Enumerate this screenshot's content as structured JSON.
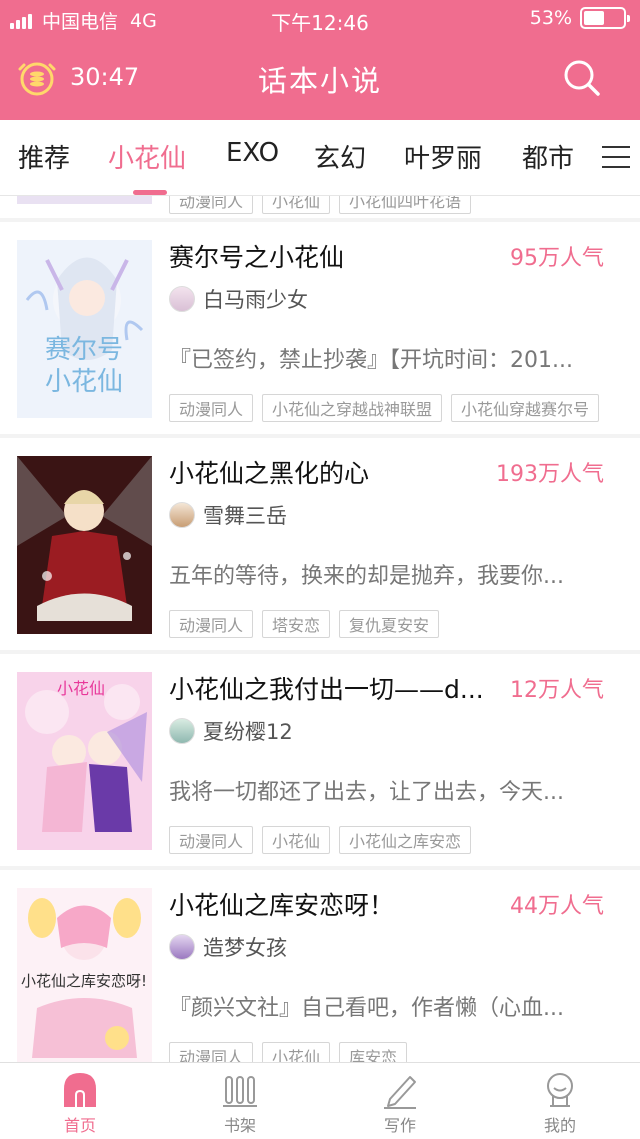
{
  "status_bar": {
    "carrier": "中国电信",
    "network": "4G",
    "time": "下午12:46",
    "battery_percent": "53%",
    "battery_level": 0.53
  },
  "title_bar": {
    "timer": "30:47",
    "title": "话本小说",
    "timer_icon": "alarm-coin-icon",
    "search_icon": "search-icon"
  },
  "tabs": [
    {
      "label": "推荐"
    },
    {
      "label": "小花仙"
    },
    {
      "label": "EXO"
    },
    {
      "label": "玄幻"
    },
    {
      "label": "叶罗丽"
    },
    {
      "label": "都市"
    }
  ],
  "active_tab": "小花仙",
  "partial_item": {
    "tags": [
      "动漫同人",
      "小花仙",
      "小花仙四叶花语"
    ]
  },
  "books": [
    {
      "title": "赛尔号之小花仙",
      "popularity": "95万人气",
      "author": "白马雨少女",
      "description": "『已签约，禁止抄袭』【开坑时间：201...",
      "tags": [
        "动漫同人",
        "小花仙之穿越战神联盟",
        "小花仙穿越赛尔号"
      ]
    },
    {
      "title": "小花仙之黑化的心",
      "popularity": "193万人气",
      "author": "雪舞三岳",
      "description": "五年的等待，换来的却是抛弃，我要你...",
      "tags": [
        "动漫同人",
        "塔安恋",
        "复仇夏安安"
      ]
    },
    {
      "title": "小花仙之我付出一切——d...",
      "popularity": "12万人气",
      "author": "夏纷樱12",
      "description": "我将一切都还了出去，让了出去，今天...",
      "tags": [
        "动漫同人",
        "小花仙",
        "小花仙之库安恋"
      ]
    },
    {
      "title": "小花仙之库安恋呀！",
      "popularity": "44万人气",
      "author": "造梦女孩",
      "description": "『颜兴文社』自己看吧，作者懒（心血...",
      "tags": [
        "动漫同人",
        "小花仙",
        "库安恋"
      ]
    }
  ],
  "bottom_nav": [
    {
      "label": "首页",
      "icon": "home-icon"
    },
    {
      "label": "书架",
      "icon": "bookshelf-icon"
    },
    {
      "label": "写作",
      "icon": "pen-icon"
    },
    {
      "label": "我的",
      "icon": "profile-icon"
    }
  ],
  "colors": {
    "accent": "#f06d8f",
    "text": "#333333",
    "muted": "#999999"
  }
}
